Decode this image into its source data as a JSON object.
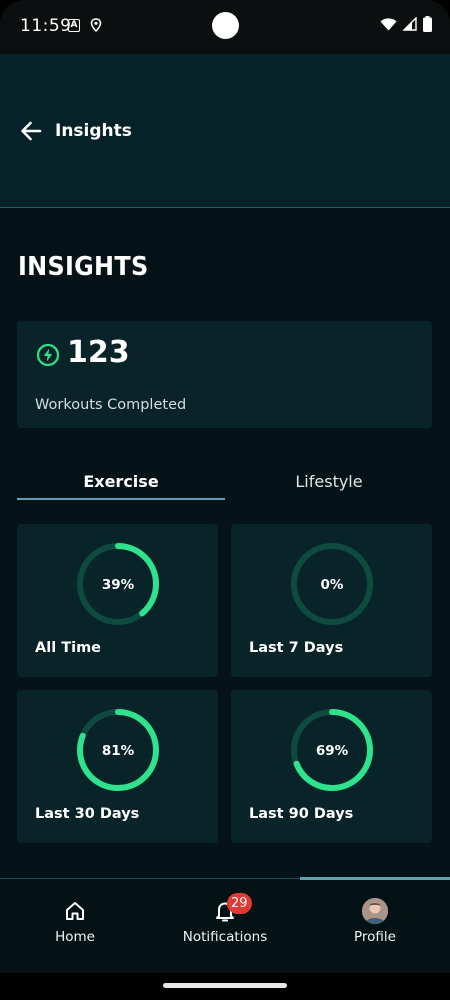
{
  "status_bar": {
    "time": "11:59",
    "a_glyph": "A"
  },
  "app_bar": {
    "title": "Insights"
  },
  "page": {
    "heading": "INSIGHTS"
  },
  "summary": {
    "value": "123",
    "label": "Workouts Completed"
  },
  "tabs": [
    {
      "label": "Exercise",
      "active": true
    },
    {
      "label": "Lifestyle",
      "active": false
    }
  ],
  "stats": [
    {
      "label": "All Time",
      "percent_text": "39%",
      "value": 39
    },
    {
      "label": "Last 7 Days",
      "percent_text": "0%",
      "value": 0
    },
    {
      "label": "Last 30 Days",
      "percent_text": "81%",
      "value": 81
    },
    {
      "label": "Last 90 Days",
      "percent_text": "69%",
      "value": 69
    }
  ],
  "bottom_nav": {
    "items": [
      {
        "label": "Home",
        "icon": "home-icon"
      },
      {
        "label": "Notifications",
        "icon": "bell-icon",
        "badge": "29"
      },
      {
        "label": "Profile",
        "icon": "avatar",
        "active": true
      }
    ]
  },
  "colors": {
    "ring_track": "#0e4a3e",
    "ring_fill": "#2ee38c",
    "bolt": "#2ee38c",
    "badge": "#e03b32"
  }
}
